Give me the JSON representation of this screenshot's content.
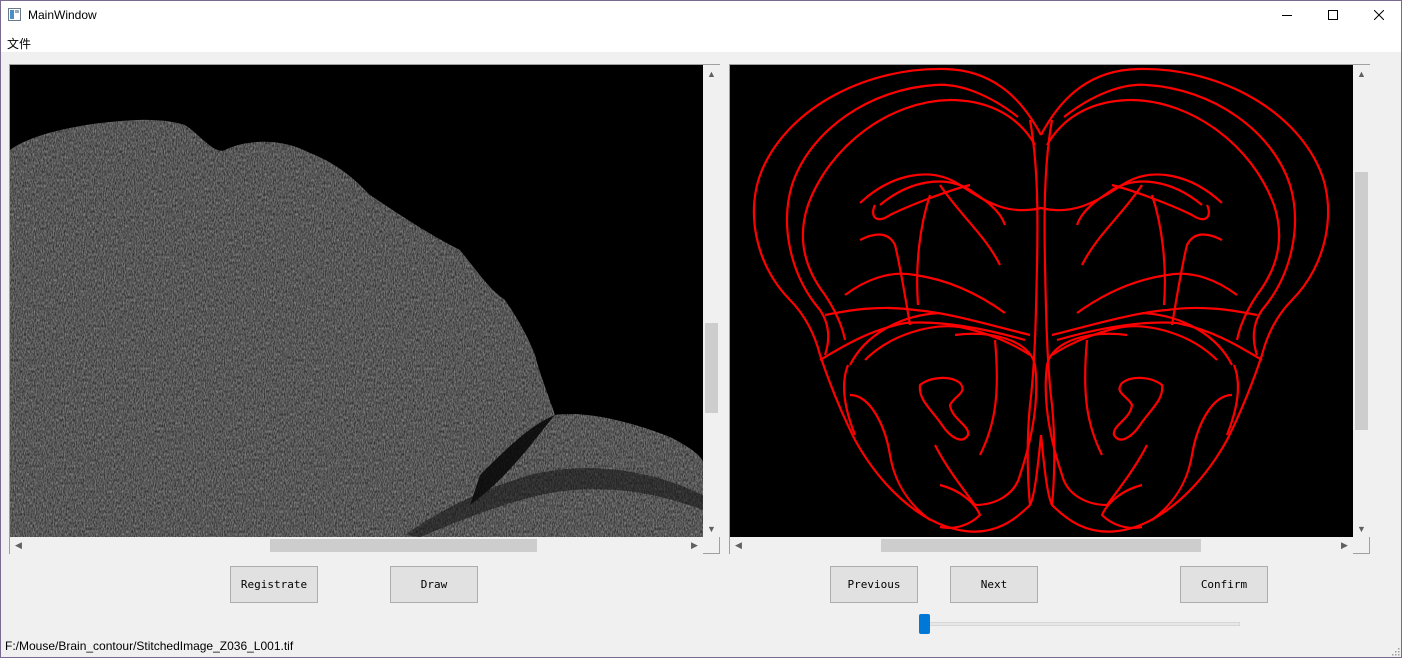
{
  "window": {
    "title": "MainWindow"
  },
  "menu": {
    "items": [
      "文件"
    ]
  },
  "left_viewer": {
    "content": "brain tissue grayscale image"
  },
  "right_viewer": {
    "content": "brain atlas contour (red outline)",
    "outline_color": "#ff0000"
  },
  "buttons": {
    "registrate": "Registrate",
    "draw": "Draw",
    "previous": "Previous",
    "next": "Next",
    "confirm": "Confirm"
  },
  "slider": {
    "value_fraction": 0.0
  },
  "status": {
    "path": "F:/Mouse/Brain_contour/StitchedImage_Z036_L001.tif"
  },
  "colors": {
    "accent": "#0078d7",
    "contour": "#ff0000"
  }
}
